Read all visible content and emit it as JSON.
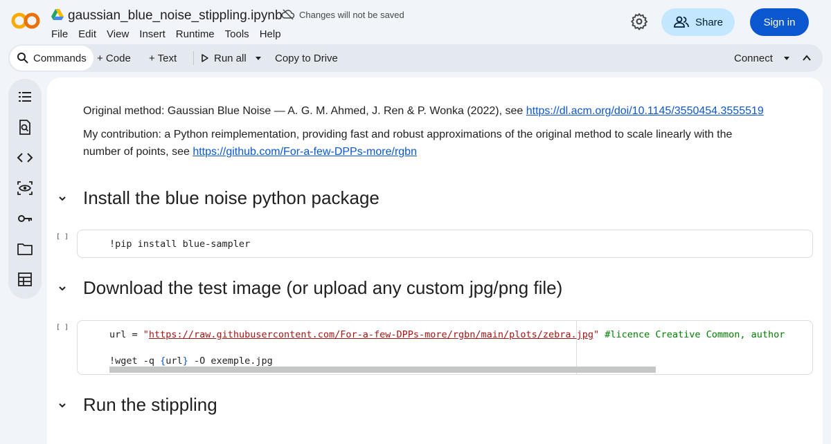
{
  "header": {
    "file_name": "gaussian_blue_noise_stippling.ipynb",
    "save_status": "Changes will not be saved",
    "menu": [
      "File",
      "Edit",
      "View",
      "Insert",
      "Runtime",
      "Tools",
      "Help"
    ],
    "share_label": "Share",
    "signin_label": "Sign in",
    "logo_text": "CO"
  },
  "toolbar": {
    "commands": "Commands",
    "code": "+ Code",
    "text": "+ Text",
    "run_all": "Run all",
    "copy_to_drive": "Copy to Drive",
    "connect": "Connect"
  },
  "sidebar": {
    "icons": [
      "table-of-contents-icon",
      "find-icon",
      "code-snippets-icon",
      "variables-icon",
      "secrets-key-icon",
      "files-folder-icon",
      "data-table-icon"
    ]
  },
  "notebook": {
    "intro_1_text": "Original method: Gaussian Blue Noise — A. G. M. Ahmed, J. Ren & P. Wonka (2022), see ",
    "intro_1_link": "https://dl.acm.org/doi/10.1145/3550454.3555519",
    "intro_2_text_a": "My contribution: a Python reimplementation, providing fast and robust approximations of the original method to scale linearly with the",
    "intro_2_text_b": "number of points, see ",
    "intro_2_link": "https://github.com/For-a-few-DPPs-more/rgbn",
    "heading_1": "Install the blue noise python package",
    "cell_1_bracket": "[ ]",
    "cell_1_code": "!pip install blue-sampler",
    "heading_2": "Download the test image (or upload any custom jpg/png file)",
    "cell_2_bracket": "[ ]",
    "cell_2_line1_a": "url = ",
    "cell_2_line1_q1": "\"",
    "cell_2_line1_str": "https://raw.githubusercontent.com/For-a-few-DPPs-more/rgbn/main/plots/zebra.jpg",
    "cell_2_line1_q2": "\"",
    "cell_2_line1_cmt": " #licence Creative Common, author",
    "cell_2_line2_a": "!wget -q ",
    "cell_2_line2_b1": "{",
    "cell_2_line2_var": "url",
    "cell_2_line2_b2": "}",
    "cell_2_line2_c": " -O exemple.jpg",
    "heading_3": "Run the stippling"
  },
  "colors": {
    "accent": "#0b57d0",
    "share_bg": "#c2e7ff",
    "background": "#f1f4f9"
  }
}
